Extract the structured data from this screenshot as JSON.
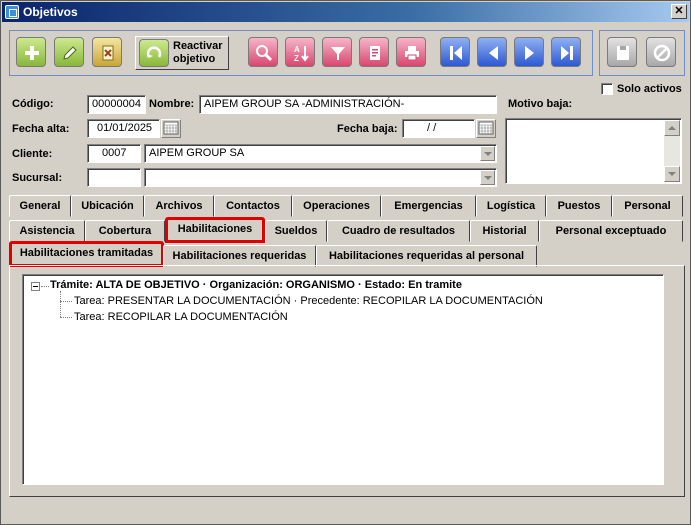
{
  "window": {
    "title": "Objetivos",
    "close_glyph": "✕"
  },
  "toolbar": {
    "reactivate_label": "Reactivar objetivo",
    "buttons": [
      "add-icon",
      "edit-icon",
      "delete-icon",
      "reactivate-icon",
      "search-icon",
      "sort-icon",
      "filter-icon",
      "report-icon",
      "print-icon",
      "first-icon",
      "previous-icon",
      "next-icon",
      "last-icon",
      "save-icon",
      "cancel-icon"
    ],
    "colors": {
      "green": "#88b83a",
      "yellow": "#c8a638",
      "pink": "#d8476f",
      "blue": "#2d58d2",
      "gray": "#a8a8a8"
    }
  },
  "form": {
    "solo_activos_label": "Solo activos",
    "codigo_label": "Código:",
    "codigo_value": "00000004",
    "nombre_label": "Nombre:",
    "nombre_value": "AIPEM GROUP SA -ADMINISTRACIÓN-",
    "motivo_baja_label": "Motivo baja:",
    "fecha_alta_label": "Fecha alta:",
    "fecha_alta_value": "01/01/2025",
    "fecha_baja_label": "Fecha baja:",
    "fecha_baja_value": "/ /",
    "cliente_label": "Cliente:",
    "cliente_code": "0007",
    "cliente_name": "AIPEM GROUP SA",
    "sucursal_label": "Sucursal:",
    "sucursal_code": "",
    "sucursal_name": ""
  },
  "tabs_row1": [
    "General",
    "Ubicación",
    "Archivos",
    "Contactos",
    "Operaciones",
    "Emergencias",
    "Logística",
    "Puestos",
    "Personal"
  ],
  "tabs_row2": [
    "Asistencia",
    "Cobertura",
    "Habilitaciones",
    "Sueldos",
    "Cuadro de resultados",
    "Historial",
    "Personal exceptuado"
  ],
  "subtabs": [
    "Habilitaciones tramitadas",
    "Habilitaciones requeridas",
    "Habilitaciones requeridas al personal"
  ],
  "selected": {
    "tab": "Habilitaciones",
    "subtab": "Habilitaciones tramitadas"
  },
  "tree": {
    "root": "Trámite: ALTA DE OBJETIVO · Organización: ORGANISMO · Estado: En tramite",
    "children": [
      "Tarea: PRESENTAR LA DOCUMENTACIÓN · Precedente: RECOPILAR LA DOCUMENTACIÓN",
      "Tarea: RECOPILAR LA DOCUMENTACIÓN"
    ]
  },
  "highlight_color": "#e00000"
}
